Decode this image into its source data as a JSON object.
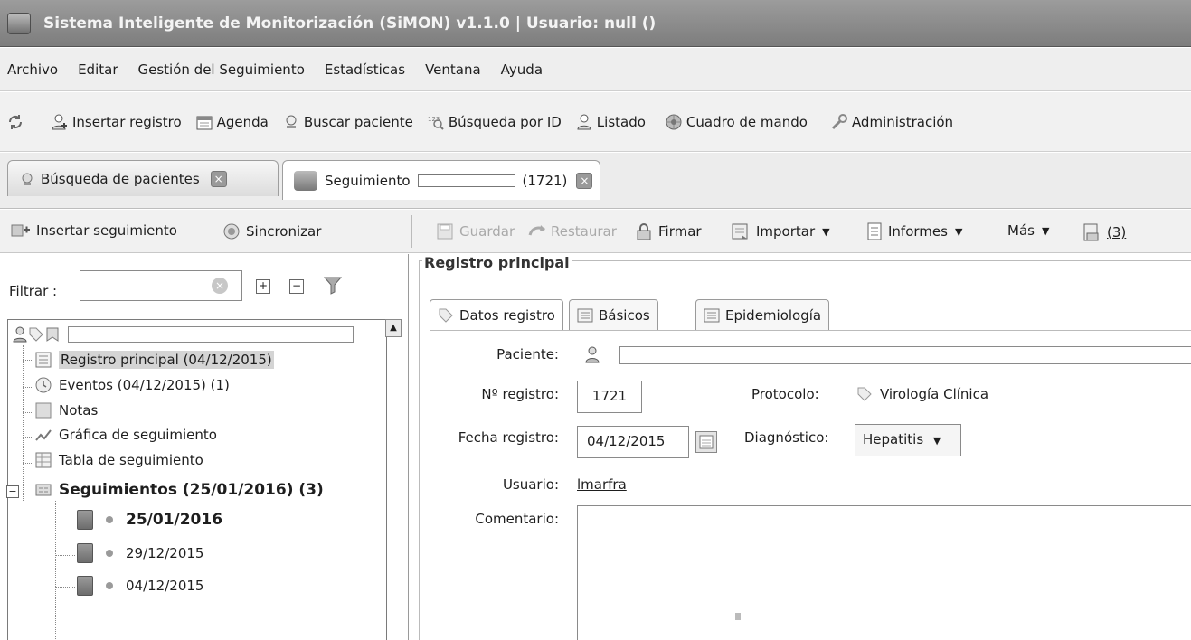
{
  "window": {
    "title": "Sistema Inteligente de Monitorización (SiMON) v1.1.0 | Usuario: null ()"
  },
  "menu": [
    "Archivo",
    "Editar",
    "Gestión del Seguimiento",
    "Estadísticas",
    "Ventana",
    "Ayuda"
  ],
  "toolbar": {
    "refresh_icon": "refresh-icon",
    "items": [
      {
        "label": "Insertar registro",
        "icon": "add-user-icon"
      },
      {
        "label": "Agenda",
        "icon": "calendar-icon"
      },
      {
        "label": "Buscar paciente",
        "icon": "search-icon"
      },
      {
        "label": "Búsqueda por ID",
        "icon": "id-search-icon"
      },
      {
        "label": "Listado",
        "icon": "user-list-icon"
      },
      {
        "label": "Cuadro de mando",
        "icon": "dashboard-icon"
      },
      {
        "label": "Administración",
        "icon": "wrench-icon"
      }
    ]
  },
  "tabs": [
    {
      "label": "Búsqueda de pacientes",
      "active": false
    },
    {
      "label": "Seguimiento",
      "suffix": "(1721)",
      "active": true
    }
  ],
  "left_toolbar": {
    "insert_label": "Insertar seguimiento",
    "sync_label": "Sincronizar"
  },
  "editor_toolbar": {
    "save_label": "Guardar",
    "restore_label": "Restaurar",
    "sign_label": "Firmar",
    "import_label": "Importar",
    "reports_label": "Informes",
    "more_label": "Más",
    "attachments_label": "(3)"
  },
  "filter": {
    "label": "Filtrar :",
    "value": ""
  },
  "tree": {
    "items": [
      {
        "label": "Registro principal (04/12/2015)",
        "selected": true
      },
      {
        "label": "Eventos (04/12/2015) (1)"
      },
      {
        "label": "Notas"
      },
      {
        "label": "Gráfica de seguimiento"
      },
      {
        "label": "Tabla de seguimiento"
      },
      {
        "label": "Seguimientos (25/01/2016) (3)",
        "bold": true
      }
    ],
    "followups": [
      "25/01/2016",
      "29/12/2015",
      "04/12/2015"
    ]
  },
  "main_panel": {
    "group_title": "Registro principal",
    "subtabs": [
      "Datos registro",
      "Básicos",
      "Epidemiología"
    ],
    "fields": {
      "patient_label": "Paciente:",
      "record_no_label": "Nº registro:",
      "record_no_value": "1721",
      "protocol_label": "Protocolo:",
      "protocol_value": "Virología Clínica",
      "date_label": "Fecha registro:",
      "date_value": "04/12/2015",
      "diagnosis_label": "Diagnóstico:",
      "diagnosis_value": "Hepatitis",
      "user_label": "Usuario:",
      "user_value": "lmarfra",
      "comment_label": "Comentario:",
      "comment_value": ""
    }
  }
}
